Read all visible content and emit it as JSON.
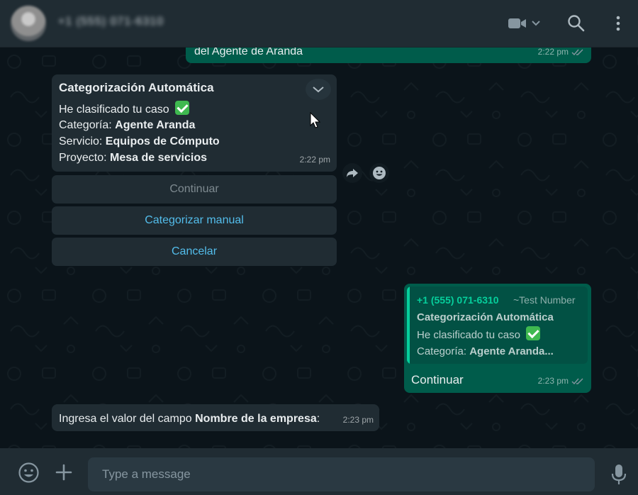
{
  "header": {
    "contact_name": "+1 (555) 071-6310",
    "icons": [
      "video-call-icon",
      "search-icon",
      "menu-icon"
    ]
  },
  "messages": {
    "top_partial": {
      "text": "del Agente de Aranda",
      "time": "2:22 pm"
    },
    "categorization": {
      "title": "Categorización Automática",
      "line1": "He clasificado tu caso",
      "line2_label": "Categoría: ",
      "line2_value": "Agente Aranda",
      "line3_label": "Servicio: ",
      "line3_value": "Equipos de Cómputo",
      "line4_label": "Proyecto: ",
      "line4_value": "Mesa de servicios",
      "time": "2:22 pm"
    },
    "actions": [
      {
        "label": "Continuar",
        "disabled": true
      },
      {
        "label": "Categorizar manual",
        "disabled": false
      },
      {
        "label": "Cancelar",
        "disabled": false
      }
    ],
    "reply": {
      "quote_phone": "+1 (555) 071-6310",
      "quote_alias": "~Test Number",
      "quote_title": "Categorización Automática",
      "quote_line1": "He clasificado tu caso",
      "quote_line2_label": "Categoría: ",
      "quote_line2_value": "Agente Aranda...",
      "text": "Continuar",
      "time": "2:23 pm"
    },
    "ask": {
      "prefix": "Ingresa el valor del campo ",
      "field": "Nombre de la empresa",
      "suffix": ":",
      "time": "2:23 pm"
    }
  },
  "footer": {
    "placeholder": "Type a message"
  },
  "colors": {
    "outgoing": "#005c4b",
    "incoming": "#202c33",
    "accent_link": "#53bdeb",
    "quote_accent": "#06cf9c",
    "background": "#0b141a"
  }
}
